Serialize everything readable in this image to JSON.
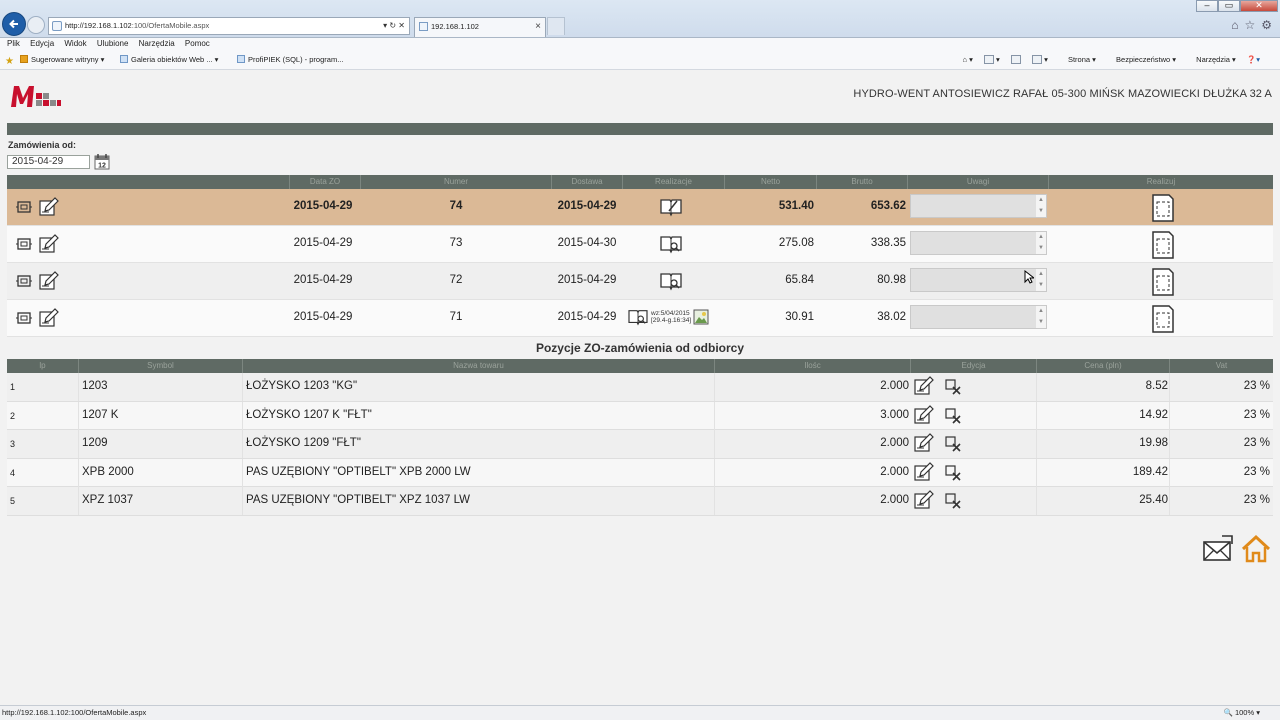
{
  "browser": {
    "address": "http://192.168.1.102:100/OfertaMobile.aspx",
    "address_host": "http://192.168.1.102",
    "address_rest": ":100/OfertaMobile.aspx",
    "tab_title": "192.168.1.102",
    "menu": [
      "Plik",
      "Edycja",
      "Widok",
      "Ulubione",
      "Narzędzia",
      "Pomoc"
    ],
    "favorites": [
      "Sugerowane witryny",
      "Galeria obiektów Web ...",
      "ProfiPIEK (SQL) - program..."
    ],
    "commands": [
      "Strona",
      "Bezpieczeństwo",
      "Narzędzia"
    ],
    "status_url": "http://192.168.1.102:100/OfertaMobile.aspx",
    "zoom": "100%"
  },
  "header": {
    "company": "HYDRO-WENT ANTOSIEWICZ RAFAŁ 05-300 MIŃSK MAZOWIECKI DŁUŻKA 32 A"
  },
  "filter": {
    "label": "Zamówienia od:",
    "date": "2015-04-29"
  },
  "orders": {
    "columns": [
      "Data ZO",
      "Numer",
      "Dostawa",
      "Realizacje",
      "Netto",
      "Brutto",
      "Uwagi",
      "Realizuj"
    ],
    "rows": [
      {
        "date": "2015-04-29",
        "number": "74",
        "delivery": "2015-04-29",
        "net": "531.40",
        "gross": "653.62",
        "note": ""
      },
      {
        "date": "2015-04-29",
        "number": "73",
        "delivery": "2015-04-30",
        "net": "275.08",
        "gross": "338.35",
        "note": ""
      },
      {
        "date": "2015-04-29",
        "number": "72",
        "delivery": "2015-04-29",
        "net": "65.84",
        "gross": "80.98",
        "note": ""
      },
      {
        "date": "2015-04-29",
        "number": "71",
        "delivery": "2015-04-29",
        "net": "30.91",
        "gross": "38.02",
        "note": "",
        "wz_line1": "wz:5/04/2015",
        "wz_line2": "[29.4-g.16:34]"
      }
    ]
  },
  "positions": {
    "title": "Pozycje ZO-zamówienia od odbiorcy",
    "columns": [
      "lp",
      "Symbol",
      "Nazwa towaru",
      "Ilośc",
      "Edycja",
      "Cena (pln)",
      "Vat"
    ],
    "rows": [
      {
        "lp": "1",
        "symbol": "1203",
        "name": "ŁOŻYSKO 1203 \"KG\"",
        "qty": "2.000",
        "price": "8.52",
        "vat": "23 %"
      },
      {
        "lp": "2",
        "symbol": "1207 K",
        "name": "ŁOŻYSKO 1207 K \"FŁT\"",
        "qty": "3.000",
        "price": "14.92",
        "vat": "23 %"
      },
      {
        "lp": "3",
        "symbol": "1209",
        "name": "ŁOŻYSKO 1209 \"FŁT\"",
        "qty": "2.000",
        "price": "19.98",
        "vat": "23 %"
      },
      {
        "lp": "4",
        "symbol": "XPB 2000",
        "name": "PAS UZĘBIONY \"OPTIBELT\" XPB 2000 LW",
        "qty": "2.000",
        "price": "189.42",
        "vat": "23 %"
      },
      {
        "lp": "5",
        "symbol": "XPZ 1037",
        "name": "PAS UZĘBIONY \"OPTIBELT\" XPZ 1037 LW",
        "qty": "2.000",
        "price": "25.40",
        "vat": "23 %"
      }
    ]
  },
  "colors": {
    "header_band": "#5f6a64",
    "selected_row": "#dbb996",
    "logo_red": "#c8102e",
    "home_orange": "#e08a1a"
  }
}
